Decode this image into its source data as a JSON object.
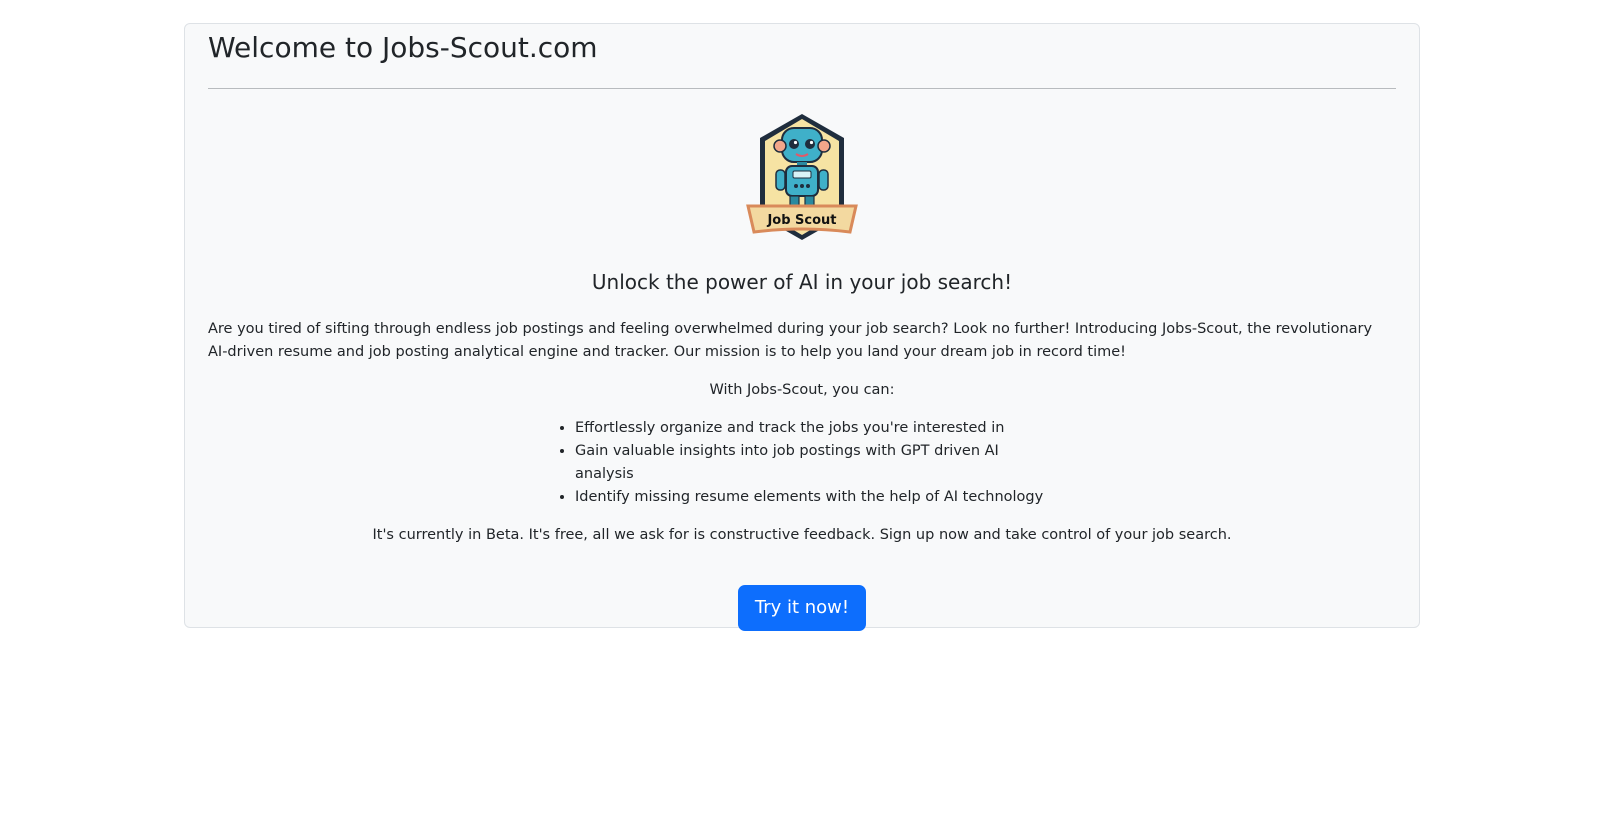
{
  "header": {
    "title": "Welcome to Jobs-Scout.com"
  },
  "logo": {
    "text": "Job Scout",
    "icon": "robot-badge-logo"
  },
  "main": {
    "tagline": "Unlock the power of AI in your job search!",
    "intro": "Are you tired of sifting through endless job postings and feeling overwhelmed during your job search? Look no further! Introducing Jobs-Scout, the revolutionary AI-driven resume and job posting analytical engine and tracker. Our mission is to help you land your dream job in record time!",
    "with_line": "With Jobs-Scout, you can:",
    "features": [
      "Effortlessly organize and track the jobs you're interested in",
      "Gain valuable insights into job postings with GPT driven AI analysis",
      "Identify missing resume elements with the help of AI technology"
    ],
    "beta": "It's currently in Beta. It's free, all we ask for is constructive feedback. Sign up now and take control of your job search.",
    "cta_label": "Try it now!"
  },
  "colors": {
    "primary": "#0d6efd",
    "card_background": "#f8f9fa",
    "card_border": "#dee2e6"
  }
}
